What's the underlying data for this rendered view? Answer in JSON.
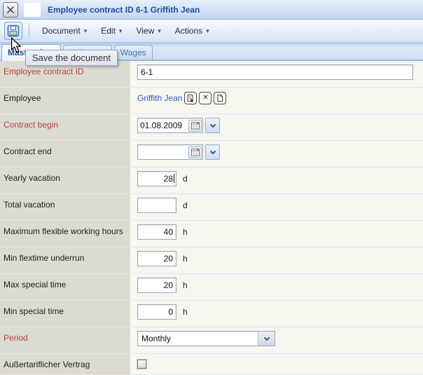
{
  "window": {
    "title": "Employee contract ID 6-1 Griffith Jean"
  },
  "toolbar": {
    "menus": [
      {
        "label": "Document"
      },
      {
        "label": "Edit"
      },
      {
        "label": "View"
      },
      {
        "label": "Actions"
      }
    ],
    "save_tooltip": "Save the document"
  },
  "tabs": [
    {
      "label": "Master data",
      "active": true
    },
    {
      "label": "Utilization",
      "active": false
    },
    {
      "label": "Wages",
      "active": false
    }
  ],
  "form": {
    "rows": [
      {
        "label": "Employee contract ID",
        "value": "6-1",
        "required": true
      },
      {
        "label": "Employee",
        "link": "Griffith Jean"
      },
      {
        "label": "Contract begin",
        "value": "01.08.2009",
        "required": true
      },
      {
        "label": "Contract end",
        "value": ""
      },
      {
        "label": "Yearly vacation",
        "value": "28",
        "unit": "d"
      },
      {
        "label": "Total vacation",
        "value": "",
        "unit": "d"
      },
      {
        "label": "Maximum flexible working hours",
        "value": "40",
        "unit": "h"
      },
      {
        "label": "Min flextime underrun",
        "value": "20",
        "unit": "h"
      },
      {
        "label": "Max special time",
        "value": "20",
        "unit": "h"
      },
      {
        "label": "Min special time",
        "value": "0",
        "unit": "h"
      },
      {
        "label": "Period",
        "value": "Monthly",
        "required": true
      },
      {
        "label": "Außertariflicher Vertrag",
        "checked": false
      }
    ]
  },
  "icons": {
    "menu_caret": "▾",
    "clear": "✕"
  },
  "colors": {
    "required_label": "#b04343",
    "link": "#3a57c4",
    "title_text": "#1d4d9e",
    "label_column_bg": "#dcdbd2",
    "field_column_bg": "#f7f6ef"
  }
}
